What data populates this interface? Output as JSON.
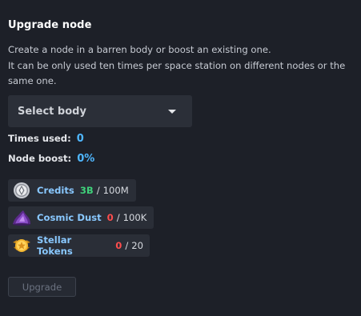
{
  "panel": {
    "title": "Upgrade node",
    "description_lines": [
      "Create a node in a barren body or boost an existing one.",
      "It can be only used ten times per space station on different nodes or the same one."
    ]
  },
  "select_body": {
    "label": "Select body",
    "icon": "chevron-down-icon"
  },
  "stats": {
    "times_used_label": "Times used:",
    "times_used_value": "0",
    "node_boost_label": "Node boost:",
    "node_boost_value": "0%"
  },
  "resources": [
    {
      "name": "Credits",
      "current": "3B",
      "max": "100M",
      "icon": "credits-coin-icon",
      "status": "sufficient"
    },
    {
      "name": "Cosmic Dust",
      "current": "0",
      "max": "100K",
      "icon": "cosmic-dust-icon",
      "status": "insufficient"
    },
    {
      "name": "Stellar Tokens",
      "current": "0",
      "max": "20",
      "icon": "stellar-token-icon",
      "status": "insufficient"
    }
  ],
  "separator": "/",
  "upgrade_button": {
    "label": "Upgrade",
    "state": "disabled"
  },
  "colors": {
    "background": "#1d2028",
    "accent_value": "#4fb7ff",
    "resource_name": "#89c8ff",
    "sufficient": "#3fd07a",
    "insufficient": "#ff4d4d"
  }
}
